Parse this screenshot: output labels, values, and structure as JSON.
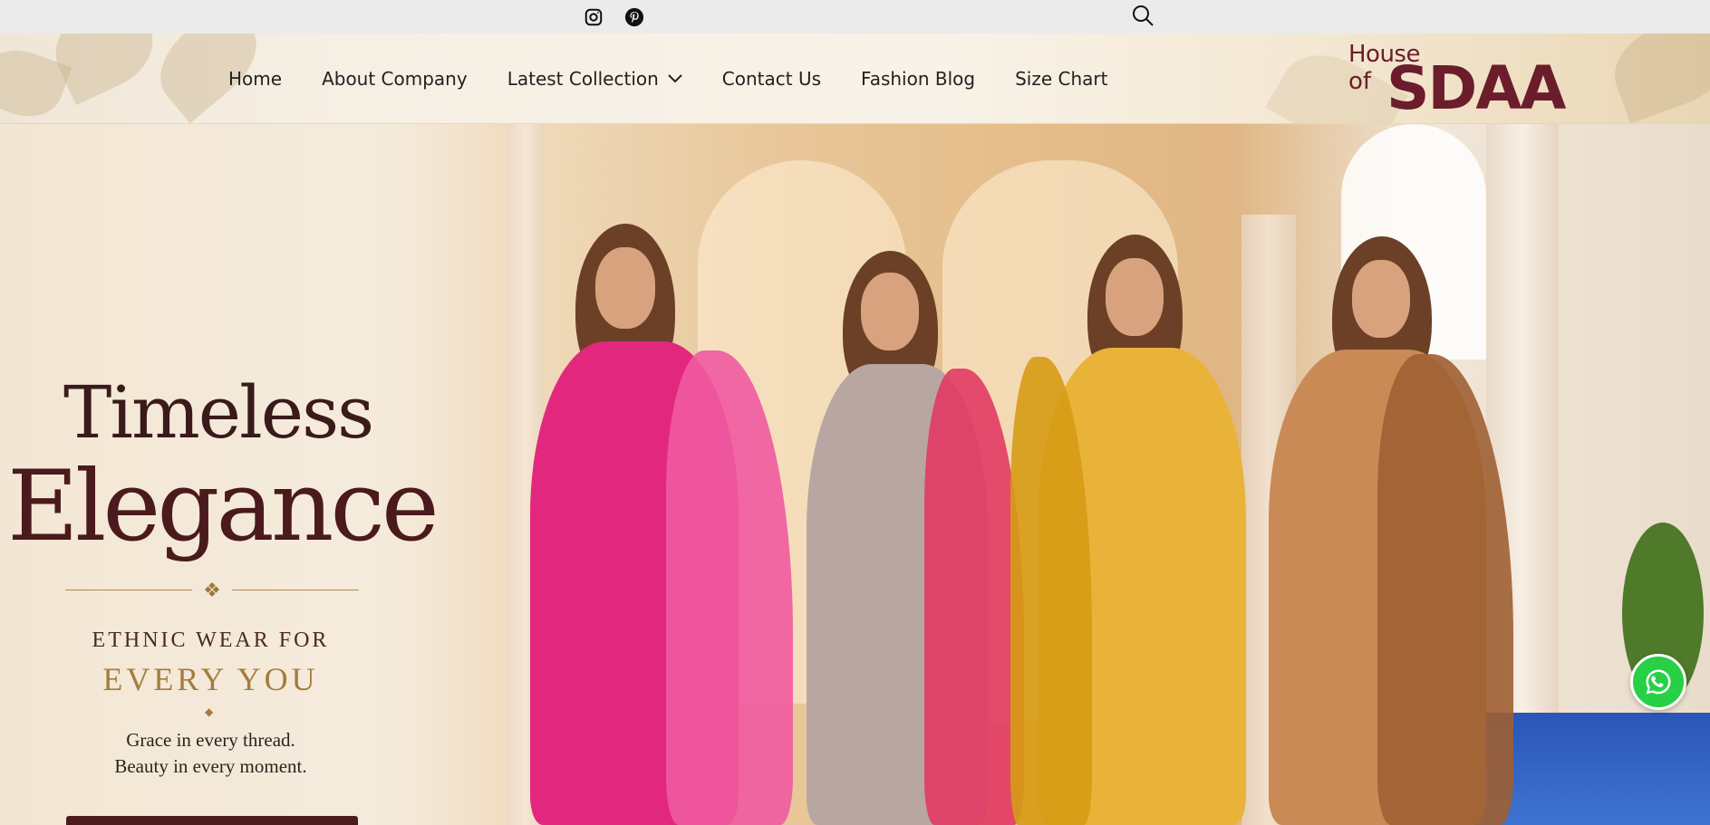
{
  "topbar": {
    "social_icons": [
      "instagram-icon",
      "pinterest-icon"
    ],
    "search_icon": "search-icon"
  },
  "nav": {
    "items": [
      {
        "label": "Home"
      },
      {
        "label": "About Company"
      },
      {
        "label": "Latest Collection",
        "has_dropdown": true
      },
      {
        "label": "Contact Us"
      },
      {
        "label": "Fashion Blog"
      },
      {
        "label": "Size Chart"
      }
    ]
  },
  "logo": {
    "house": "House",
    "of": "of",
    "brand": "SDAA",
    "color": "#6b1d2c"
  },
  "hero": {
    "title_line1": "Timeless",
    "title_line2": "Elegance",
    "subtitle_line1": "ETHNIC WEAR FOR",
    "subtitle_line2": "EVERY YOU",
    "tagline_line1": "Grace in every thread.",
    "tagline_line2": "Beauty in every moment."
  },
  "colors": {
    "accent_maroon": "#4a1a1c",
    "gold": "#a47c3e",
    "whatsapp_green": "#27d045"
  },
  "floating": {
    "whatsapp_icon": "whatsapp-icon"
  }
}
